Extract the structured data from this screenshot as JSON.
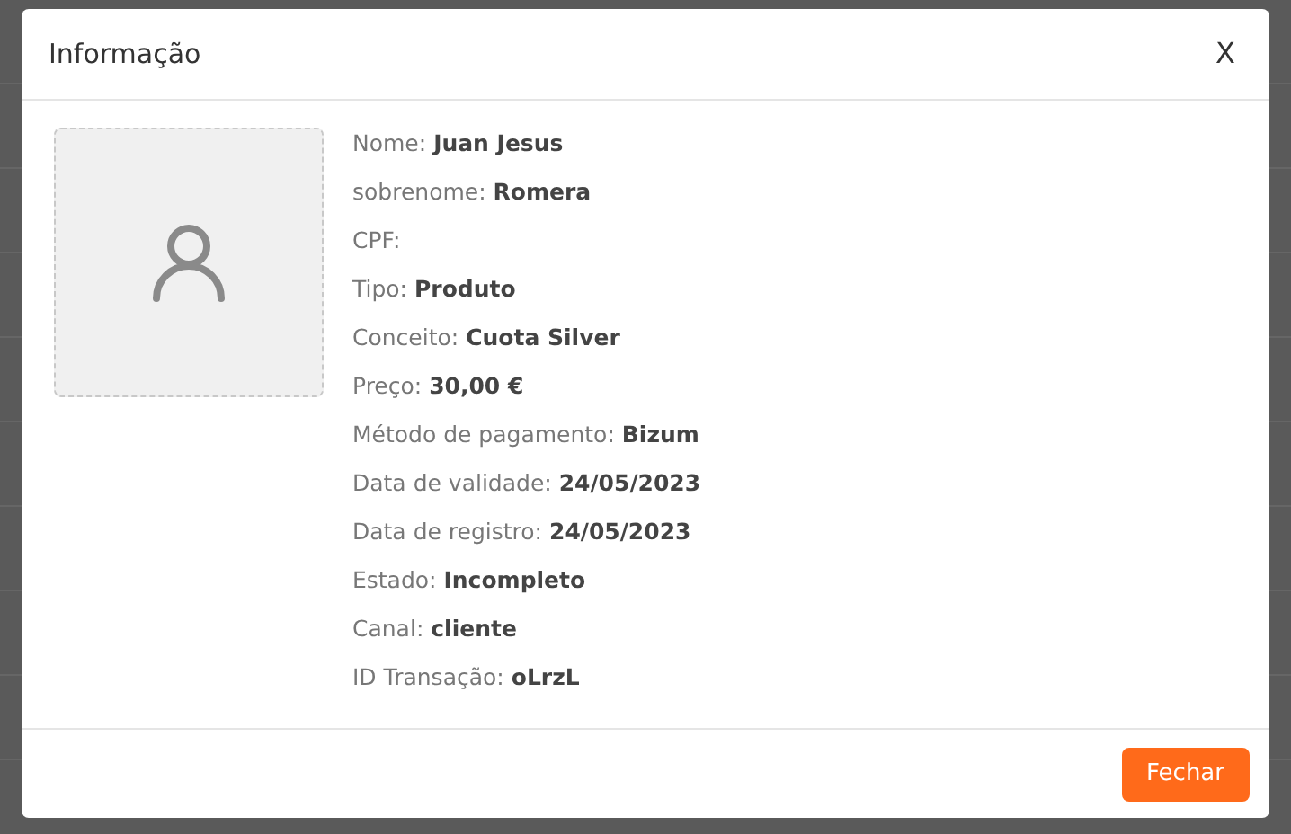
{
  "dialog": {
    "title": "Informação",
    "close": "X",
    "fields": [
      {
        "label": "Nome:",
        "value": "Juan Jesus"
      },
      {
        "label": "sobrenome:",
        "value": "Romera"
      },
      {
        "label": "CPF:"
      },
      {
        "label": "Tipo:",
        "value": "Produto"
      },
      {
        "label": "Conceito:",
        "value": "Cuota Silver"
      },
      {
        "label": "Preço:",
        "value": "30,00 €"
      },
      {
        "label": "Método de pagamento:",
        "value": "Bizum"
      },
      {
        "label": "Data de validade:",
        "value": "24/05/2023"
      },
      {
        "label": "Data de registro:",
        "value": "24/05/2023"
      },
      {
        "label": "Estado:",
        "value": "Incompleto"
      },
      {
        "label": "Canal:",
        "value": "cliente"
      },
      {
        "label": "ID Transação:",
        "value": "oLrzL"
      }
    ],
    "buttons": [
      "Fechar"
    ]
  }
}
